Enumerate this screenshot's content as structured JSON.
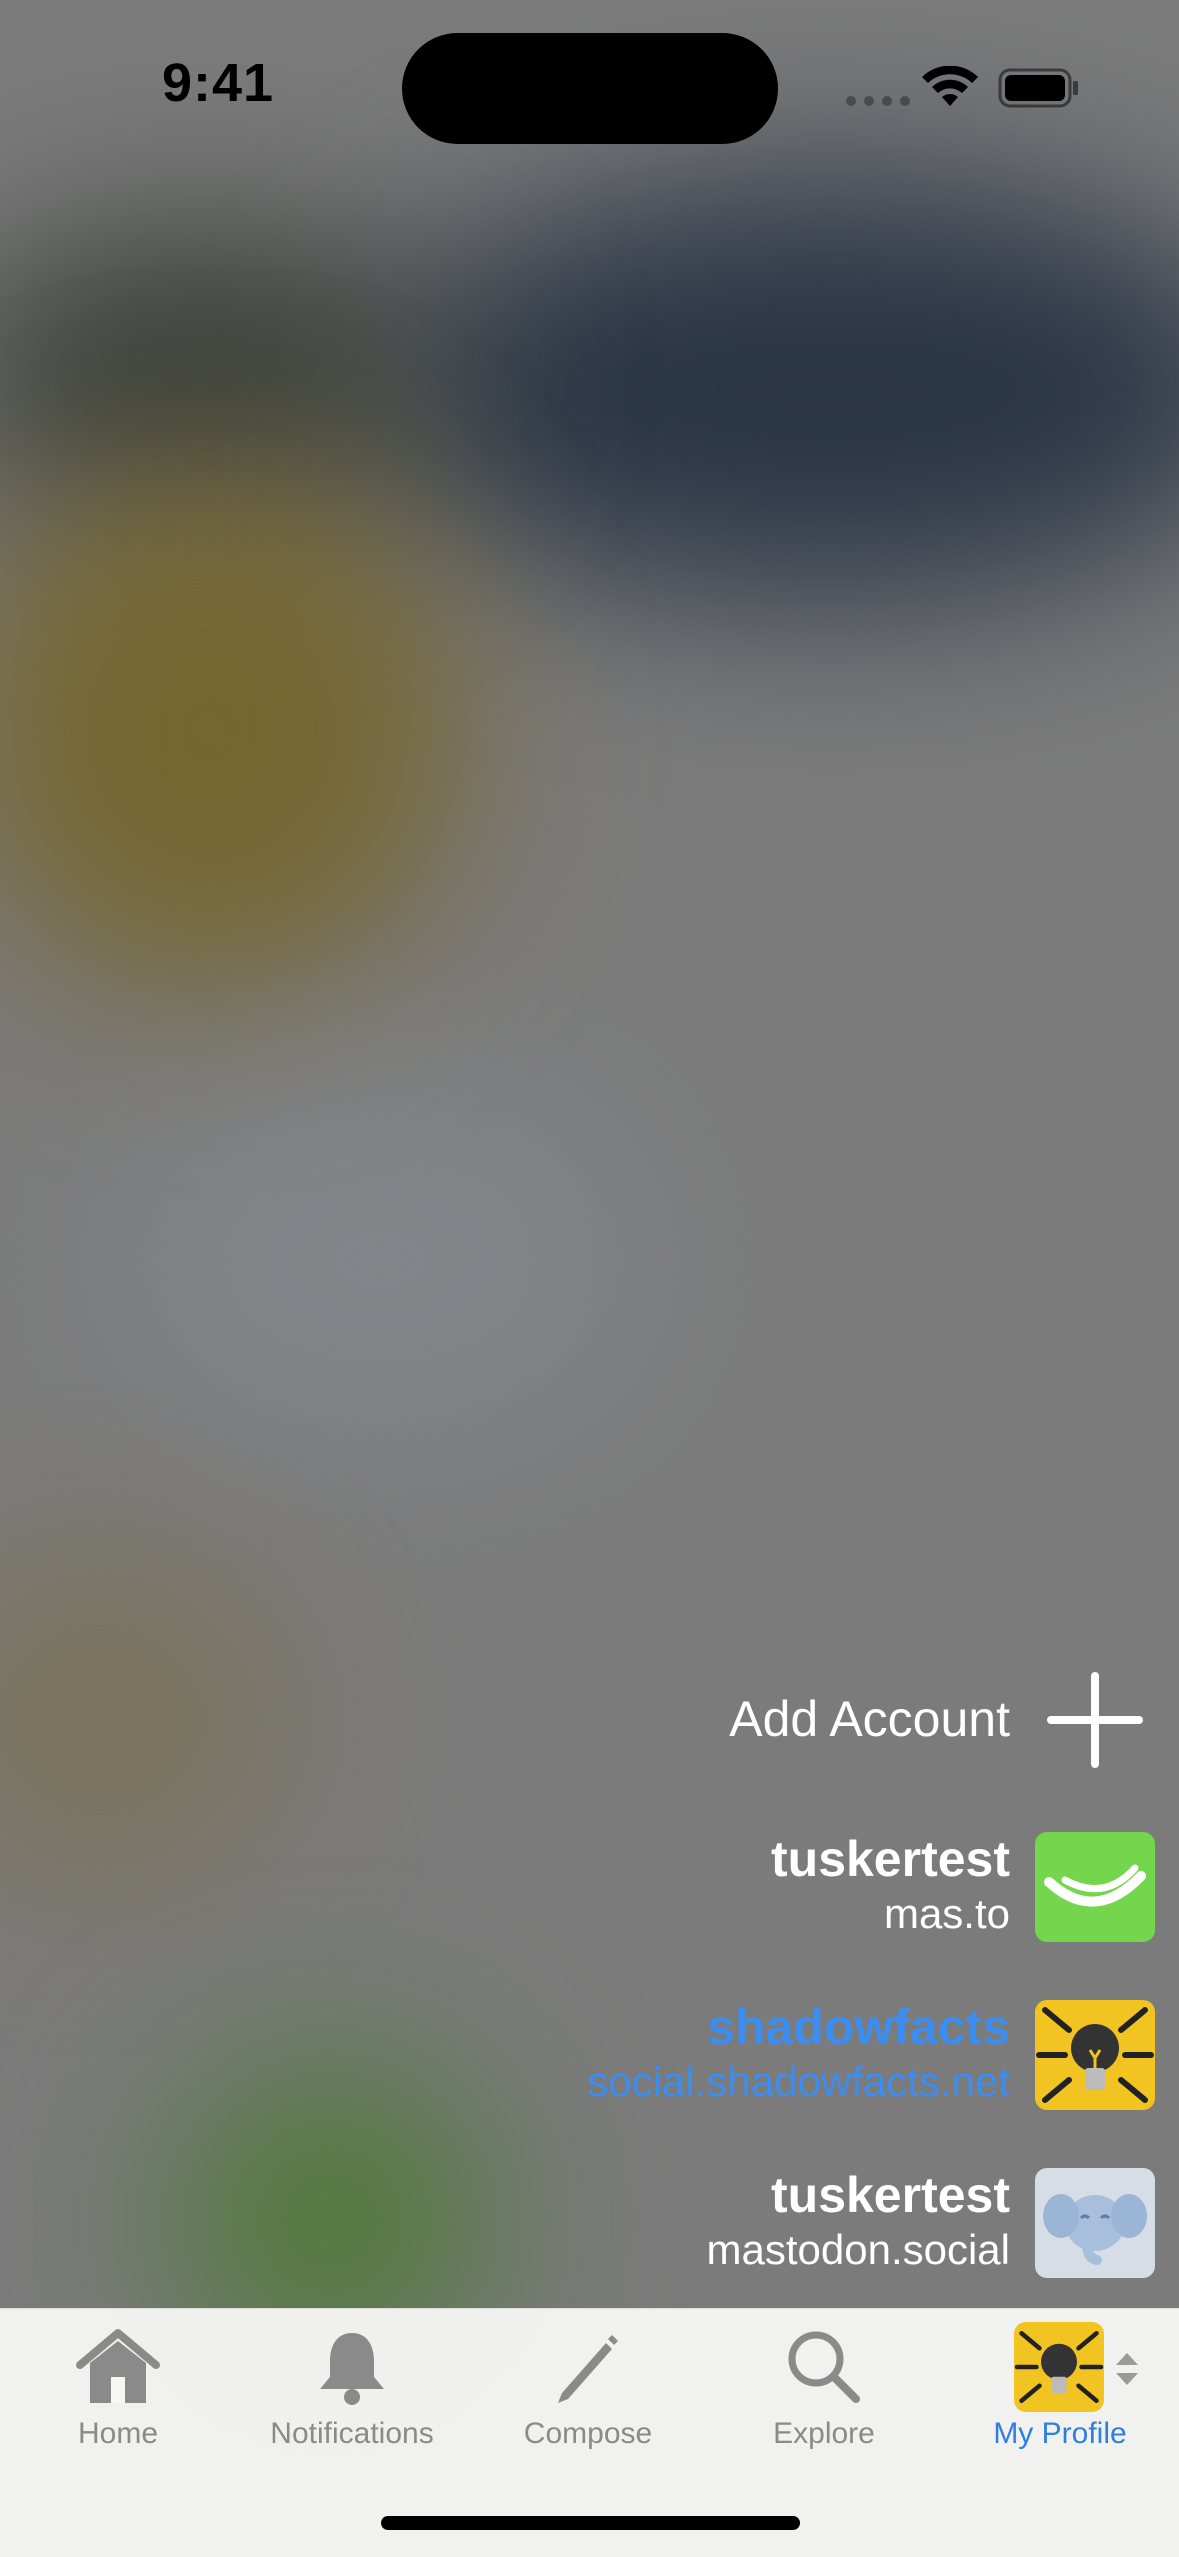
{
  "status_bar": {
    "time": "9:41",
    "icons": [
      "cellular-signal-icon",
      "wifi-icon",
      "battery-icon"
    ]
  },
  "account_switcher": {
    "add_account_label": "Add Account",
    "accounts": [
      {
        "name": "tuskertest",
        "instance": "mas.to",
        "active": false,
        "avatar": "green-smile-avatar"
      },
      {
        "name": "shadowfacts",
        "instance": "social.shadowfacts.net",
        "active": true,
        "avatar": "lightbulb-avatar"
      },
      {
        "name": "tuskertest",
        "instance": "mastodon.social",
        "active": false,
        "avatar": "mastodon-elephant-avatar"
      }
    ]
  },
  "tab_bar": {
    "tabs": [
      {
        "label": "Home",
        "icon": "house-icon"
      },
      {
        "label": "Notifications",
        "icon": "bell-icon"
      },
      {
        "label": "Compose",
        "icon": "pencil-icon"
      },
      {
        "label": "Explore",
        "icon": "magnifying-glass-icon"
      },
      {
        "label": "My Profile",
        "icon": "lightbulb-avatar",
        "active": true
      }
    ]
  },
  "colors": {
    "accent": "#3b8df0",
    "active_tab": "#2f7fe0",
    "inactive_tab": "#8a8a8a"
  }
}
